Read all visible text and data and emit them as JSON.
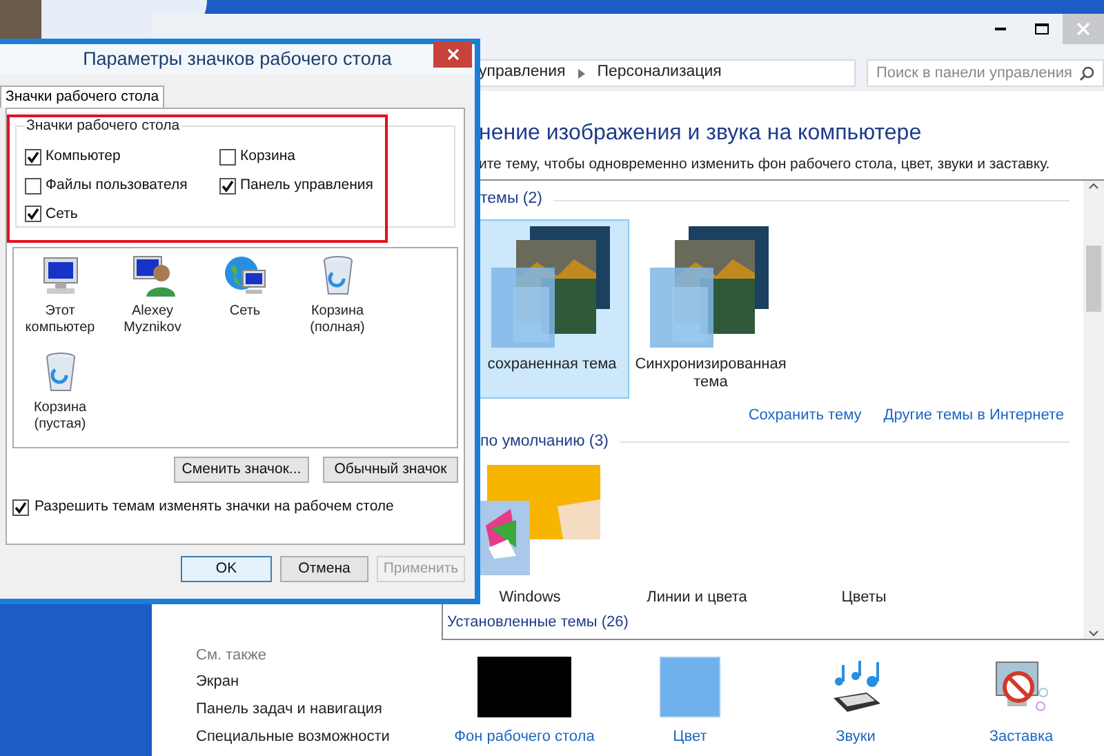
{
  "control_panel": {
    "breadcrumb": [
      {
        "label": "управления"
      },
      {
        "label": "Персонализация"
      }
    ],
    "search_placeholder": "Поиск в панели управления",
    "heading": "нение изображения и звука на компьютере",
    "subtitle": "ите тему, чтобы одновременно изменить фон рабочего стола, цвет, звуки и заставку.",
    "my_themes": {
      "title": "темы (2)",
      "items": [
        {
          "label": "сохраненная тема",
          "kind": "landscape",
          "selected": true
        },
        {
          "label": "Синхронизированная тема",
          "kind": "landscape",
          "selected": false
        }
      ]
    },
    "links": [
      "Сохранить тему",
      "Другие темы в Интернете"
    ],
    "default_themes": {
      "title": "по умолчанию (3)",
      "items": [
        {
          "label": "Windows",
          "kind": "windows"
        },
        {
          "label": "Линии и цвета",
          "kind": "blank"
        },
        {
          "label": "Цветы",
          "kind": "blank"
        }
      ]
    },
    "installed_title": "Установленные темы (26)",
    "see_also": {
      "title": "См. также",
      "links": [
        "Экран",
        "Панель задач и навигация",
        "Специальные возможности"
      ]
    },
    "bottom": [
      {
        "label": "Фон рабочего стола",
        "kind": "wallpaper"
      },
      {
        "label": "Цвет",
        "kind": "color"
      },
      {
        "label": "Звуки",
        "kind": "sounds"
      },
      {
        "label": "Заставка",
        "kind": "screensaver"
      }
    ]
  },
  "dialog": {
    "title": "Параметры значков рабочего стола",
    "tab": {
      "label": "Значки рабочего стола",
      "selected": true
    },
    "group_title": "Значки рабочего стола",
    "checkboxes": [
      {
        "label": "Компьютер",
        "checked": true
      },
      {
        "label": "Корзина",
        "checked": false
      },
      {
        "label": "Файлы пользователя",
        "checked": false
      },
      {
        "label": "Панель управления",
        "checked": true
      },
      {
        "label": "Сеть",
        "checked": true
      }
    ],
    "icons": [
      {
        "label": "Этот компьютер",
        "kind": "computer"
      },
      {
        "label": "Alexey Myznikov",
        "kind": "user"
      },
      {
        "label": "Сеть",
        "kind": "network"
      },
      {
        "label": "Корзина (полная)",
        "kind": "bin"
      },
      {
        "label": "Корзина (пустая)",
        "kind": "bin"
      }
    ],
    "buttons": [
      "Сменить значок...",
      "Обычный значок"
    ],
    "allow_themes": {
      "label": "Разрешить темам изменять значки на рабочем столе",
      "checked": true
    },
    "footer_buttons": [
      {
        "label": "OK",
        "kind": "default",
        "disabled": false
      },
      {
        "label": "Отмена",
        "kind": "normal",
        "disabled": false
      },
      {
        "label": "Применить",
        "kind": "normal",
        "disabled": true
      }
    ]
  }
}
